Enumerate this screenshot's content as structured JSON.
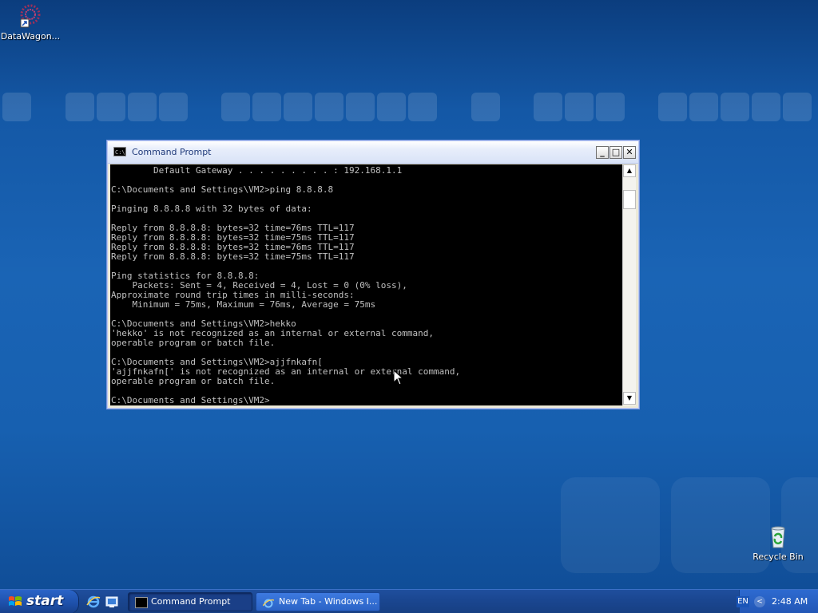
{
  "desktop": {
    "icons": [
      {
        "label": "DataWagon..."
      },
      {
        "label": "Recycle Bin"
      }
    ]
  },
  "window": {
    "title": "Command Prompt",
    "minimize_glyph": "_",
    "maximize_glyph": "□",
    "close_glyph": "✕",
    "console_text": "        Default Gateway . . . . . . . . . : 192.168.1.1\n\nC:\\Documents and Settings\\VM2>ping 8.8.8.8\n\nPinging 8.8.8.8 with 32 bytes of data:\n\nReply from 8.8.8.8: bytes=32 time=76ms TTL=117\nReply from 8.8.8.8: bytes=32 time=75ms TTL=117\nReply from 8.8.8.8: bytes=32 time=76ms TTL=117\nReply from 8.8.8.8: bytes=32 time=75ms TTL=117\n\nPing statistics for 8.8.8.8:\n    Packets: Sent = 4, Received = 4, Lost = 0 (0% loss),\nApproximate round trip times in milli-seconds:\n    Minimum = 75ms, Maximum = 76ms, Average = 75ms\n\nC:\\Documents and Settings\\VM2>hekko\n'hekko' is not recognized as an internal or external command,\noperable program or batch file.\n\nC:\\Documents and Settings\\VM2>ajjfnkafn[\n'ajjfnkafn[' is not recognized as an internal or external command,\noperable program or batch file.\n\nC:\\Documents and Settings\\VM2>"
  },
  "taskbar": {
    "start_label": "start",
    "tasks": [
      {
        "label": "Command Prompt",
        "active": true
      },
      {
        "label": "New Tab - Windows I...",
        "active": false
      }
    ],
    "tray": {
      "language": "EN",
      "clock": "2:48 AM"
    }
  },
  "colors": {
    "console_bg": "#000000",
    "console_fg": "#c0c0c0",
    "taskbar": "#1a4690",
    "desktop": "#1a64b5"
  }
}
